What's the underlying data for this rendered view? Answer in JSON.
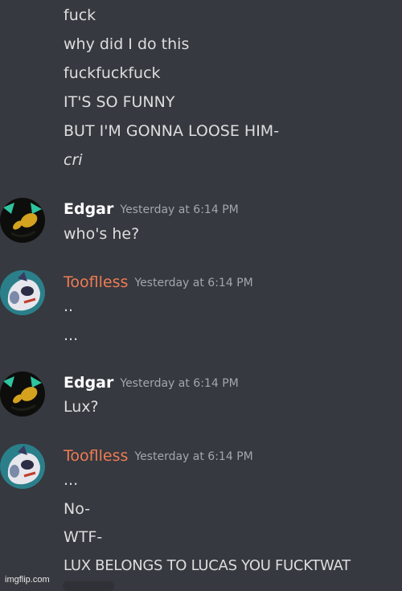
{
  "messages": {
    "top_continuation": [
      "fuck",
      "why did I do this",
      "fuckfuckfuck",
      "IT'S SO FUNNY",
      "BUT I'M GONNA LOOSE HIM-",
      "cri"
    ],
    "groups": [
      {
        "author": "Edgar",
        "author_color": "#ffffff",
        "timestamp": "Yesterday at 6:14 PM",
        "lines": [
          "who's he?"
        ]
      },
      {
        "author": "Tooflless",
        "author_color": "#f07b54",
        "timestamp": "Yesterday at 6:14 PM",
        "lines": [
          "..",
          "..."
        ]
      },
      {
        "author": "Edgar",
        "author_color": "#ffffff",
        "timestamp": "Yesterday at 6:14 PM",
        "lines": [
          "Lux?"
        ]
      },
      {
        "author": "Tooflless",
        "author_color": "#f07b54",
        "timestamp": "Yesterday at 6:14 PM",
        "lines": [
          "...",
          "No-",
          "WTF-",
          "LUX BELONGS TO LUCAS YOU FUCKTWAT"
        ]
      }
    ]
  },
  "watermark": "imgflip.com",
  "colors": {
    "background": "#36393f",
    "message_text": "#dcddde",
    "timestamp": "#a3a6aa",
    "tooflless_name": "#f07b54"
  }
}
